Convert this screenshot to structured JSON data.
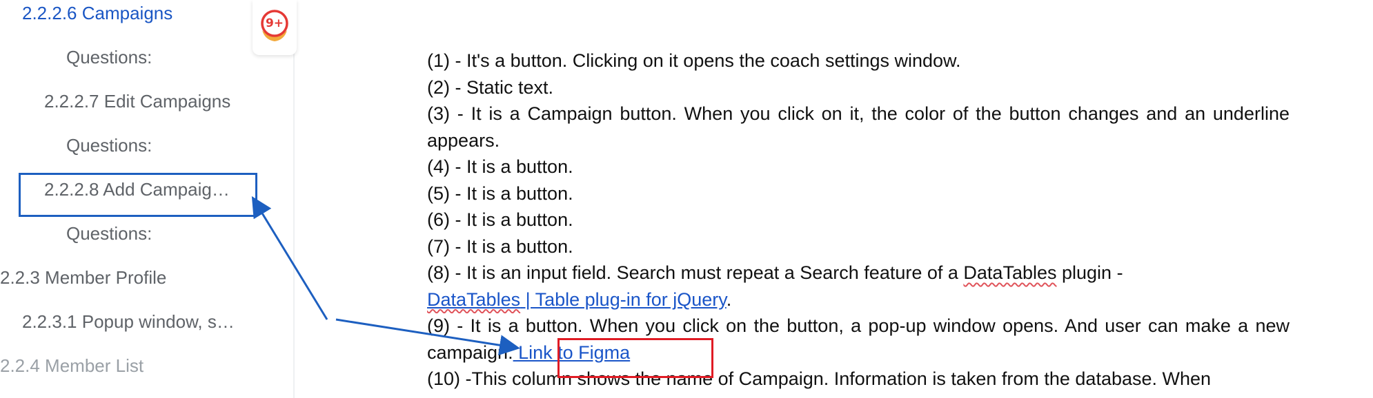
{
  "outline": {
    "items": [
      {
        "id": "2-2-2-6",
        "label": "2.2.2.6 Campaigns",
        "state": "active"
      },
      {
        "id": "q1",
        "label": "Questions:",
        "state": "normal"
      },
      {
        "id": "2-2-2-7",
        "label": "2.2.2.7 Edit Campaigns",
        "state": "normal"
      },
      {
        "id": "q2",
        "label": "Questions:",
        "state": "normal"
      },
      {
        "id": "2-2-2-8",
        "label": "2.2.2.8 Add Campaig…",
        "state": "normal"
      },
      {
        "id": "q3",
        "label": "Questions:",
        "state": "normal"
      },
      {
        "id": "2-2-3",
        "label": "2.2.3 Member Profile",
        "state": "normal"
      },
      {
        "id": "2-2-3-1",
        "label": "2.2.3.1 Popup window, s…",
        "state": "normal"
      },
      {
        "id": "2-2-4",
        "label": "2.2.4 Member List",
        "state": "faded"
      }
    ]
  },
  "notifications": {
    "count": "9+",
    "icon": "notification-badge-icon"
  },
  "document": {
    "lines": {
      "l1": "(1) - It's a button. Clicking on it opens the coach settings window.",
      "l2": "(2) - Static text.",
      "l3": "(3) - It is a Campaign button. When you click on it, the color of the button changes and an underline appears.",
      "l4": "(4) - It is a button.",
      "l5": "(5) - It is a button.",
      "l6": "(6) - It is a button.",
      "l7": "(7) - It is a button.",
      "l8_prefix": "(8) -  It is an input field. Search must repeat a Search feature of a ",
      "l8_term": "DataTables",
      "l8_suffix": " plugin -",
      "l8_link_term": "DataTables",
      "l8_link_rest": " | Table plug-in for jQuery",
      "l8_period": ".",
      "l9_text": "(9) - It is a button. When you click on the button, a pop-up window opens. And user can  make a new campaign.",
      "l9_link": " Link to Figma",
      "l10": "(10) -This column shows the name of Campaign. Information is taken from the database. When"
    }
  },
  "colors": {
    "active_outline": "#1a56c4",
    "link": "#1a55c8",
    "highlight_box_blue": "#1d5fc0",
    "highlight_box_red": "#e01b24",
    "badge_red": "#e53935",
    "badge_orange": "#f2a93b"
  }
}
